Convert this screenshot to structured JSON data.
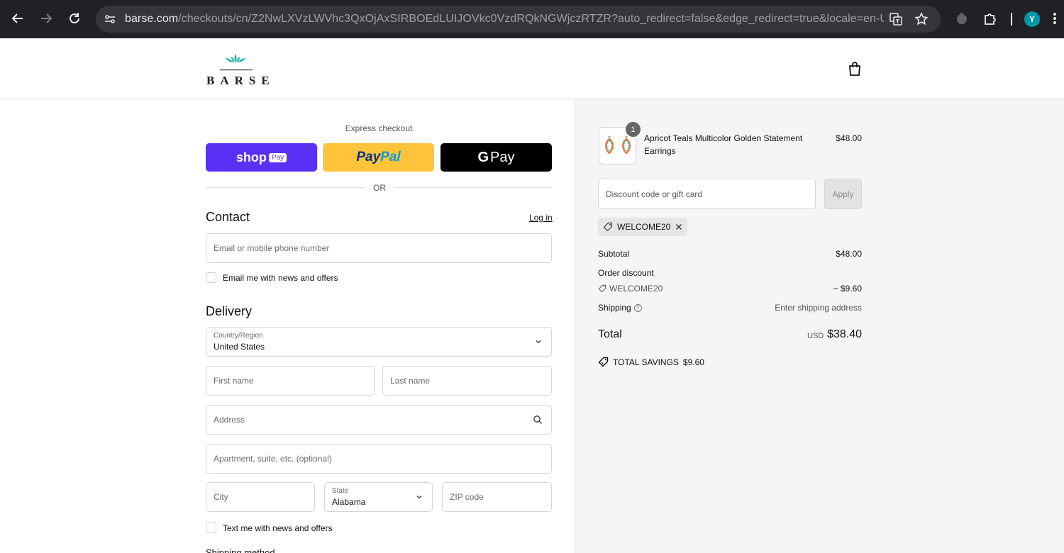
{
  "browser": {
    "url_host": "barse.com",
    "url_path": "/checkouts/cn/Z2NwLXVzLWVhc3QxOjAxSIRBOEdLUIJOVkc0VzdRQkNGWjczRTZR?auto_redirect=false&edge_redirect=true&locale=en-US&ski...",
    "profile_initial": "Y",
    "icons": [
      "back-icon",
      "forward-icon",
      "reload-icon",
      "site-info-icon",
      "translate-icon",
      "bookmark-star-icon",
      "extension-icon",
      "puzzle-icon",
      "more-icon"
    ]
  },
  "header": {
    "logo_text": "BARSE",
    "bag_icon": "shopping-bag-icon"
  },
  "express": {
    "label": "Express checkout",
    "shop_label": "shop",
    "shop_pill": "Pay",
    "paypal_part1": "Pay",
    "paypal_part2": "Pal",
    "gpay_g": "G",
    "gpay_label": "Pay",
    "or_text": "OR"
  },
  "contact": {
    "title": "Contact",
    "login": "Log in",
    "email_placeholder": "Email or mobile phone number",
    "news_label": "Email me with news and offers"
  },
  "delivery": {
    "title": "Delivery",
    "country_label": "Country/Region",
    "country_value": "United States",
    "first_name": "First name",
    "last_name": "Last name",
    "address": "Address",
    "apartment": "Apartment, suite, etc. (optional)",
    "city": "City",
    "state_label": "State",
    "state_value": "Alabama",
    "zip": "ZIP code",
    "text_label": "Text me with news and offers",
    "shipping_method": "Shipping method"
  },
  "summary": {
    "item": {
      "name": "Apricot Teals Multicolor Golden Statement Earrings",
      "price": "$48.00",
      "quantity": "1"
    },
    "discount_placeholder": "Discount code or gift card",
    "apply": "Apply",
    "applied_code": "WELCOME20",
    "subtotal_label": "Subtotal",
    "subtotal_value": "$48.00",
    "order_discount_label": "Order discount",
    "discount_code": "WELCOME20",
    "discount_value": "− $9.60",
    "shipping_label": "Shipping",
    "shipping_value": "Enter shipping address",
    "total_label": "Total",
    "total_currency": "USD",
    "total_value": "$38.40",
    "savings_label": "TOTAL SAVINGS",
    "savings_value": "$9.60"
  },
  "colors": {
    "shop_pay": "#5a31f4",
    "paypal": "#ffc439",
    "gpay": "#000000",
    "summary_bg": "#f5f5f7",
    "logo_accent": "#1fb2b0"
  }
}
